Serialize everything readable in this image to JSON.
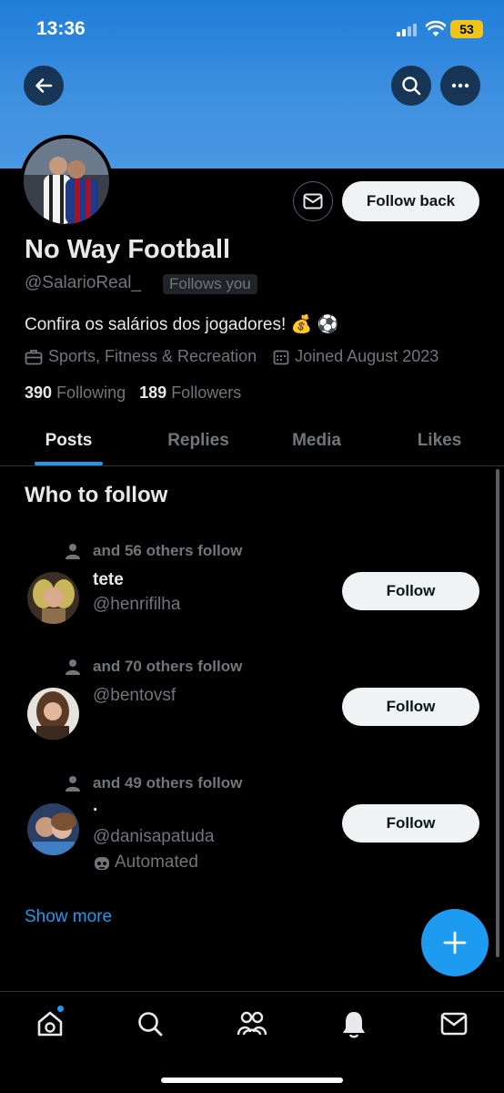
{
  "status_bar": {
    "time": "13:36",
    "battery": "53"
  },
  "profile": {
    "name": "No Way Football",
    "handle": "@SalarioReal_",
    "follows_you": "Follows you",
    "bio": "Confira os salários dos jogadores! 💰 ⚽",
    "category": "Sports, Fitness & Recreation",
    "joined": "Joined August 2023",
    "following_count": "390",
    "following_label": "Following",
    "followers_count": "189",
    "followers_label": "Followers",
    "follow_back_label": "Follow back"
  },
  "tabs": [
    "Posts",
    "Replies",
    "Media",
    "Likes"
  ],
  "who_to_follow": {
    "title": "Who to follow",
    "follow_label": "Follow",
    "suggestions": [
      {
        "social": "and 56 others follow",
        "name": "tete",
        "handle": "@henrifilha"
      },
      {
        "social": "and 70 others follow",
        "handle": "@bentovsf"
      },
      {
        "social": "and 49 others follow",
        "name": "·",
        "handle": "@danisapatuda",
        "badge": "Automated"
      }
    ],
    "show_more": "Show more"
  },
  "colors": {
    "accent": "#1d9bf0",
    "banner": "#3d8fe0",
    "background": "#000000"
  },
  "icons": {
    "nav": [
      "home-icon",
      "search-icon",
      "communities-icon",
      "notifications-icon",
      "messages-icon"
    ],
    "header": [
      "back-arrow-icon",
      "search-icon",
      "more-icon"
    ]
  }
}
